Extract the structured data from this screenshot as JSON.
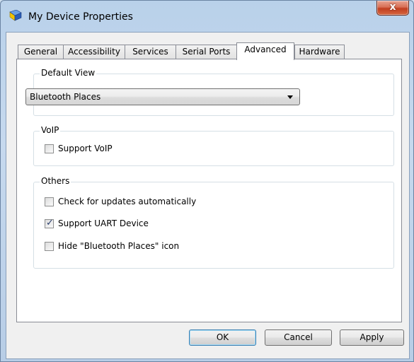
{
  "window": {
    "title": "My Device Properties",
    "close_label": "x"
  },
  "tabs": [
    {
      "label": "General"
    },
    {
      "label": "Accessibility"
    },
    {
      "label": "Services"
    },
    {
      "label": "Serial Ports"
    },
    {
      "label": "Advanced",
      "active": true
    },
    {
      "label": "Hardware"
    }
  ],
  "default_view": {
    "group_title": "Default View",
    "selected": "Bluetooth Places"
  },
  "voip": {
    "group_title": "VoIP",
    "support_voip": {
      "label": "Support VoIP",
      "checked": false
    }
  },
  "others": {
    "group_title": "Others",
    "check_updates": {
      "label": "Check for updates automatically",
      "checked": false
    },
    "support_uart": {
      "label": "Support UART Device",
      "checked": true
    },
    "hide_icon": {
      "label": "Hide \"Bluetooth Places\" icon",
      "checked": false
    }
  },
  "buttons": {
    "ok": "OK",
    "cancel": "Cancel",
    "apply": "Apply"
  },
  "colors": {
    "accent_border": "#3c7fb1",
    "close_red": "#c13e20",
    "check_mark": "#2a3f6d"
  },
  "icons": {
    "app": "bluetooth-device-icon",
    "close": "close-icon",
    "dropdown": "chevron-down-icon"
  }
}
